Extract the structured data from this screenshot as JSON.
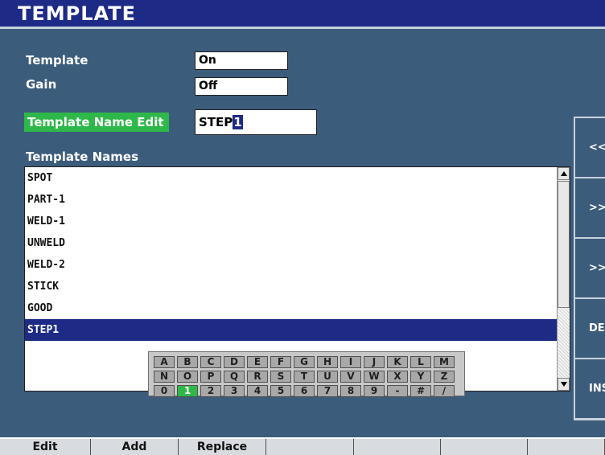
{
  "title": "TEMPLATE",
  "settings": {
    "template_label": "Template",
    "template_value": "On",
    "gain_label": "Gain",
    "gain_value": "Off",
    "name_edit_label": "Template Name Edit",
    "name_edit_value": "STEP",
    "name_edit_cursor": "1"
  },
  "list": {
    "header": "Template Names",
    "items": [
      "SPOT",
      "PART-1",
      "WELD-1",
      "UNWELD",
      "WELD-2",
      "STICK",
      "GOOD",
      "STEP1"
    ],
    "selected_index": 7
  },
  "keyboard": {
    "rows": [
      [
        "A",
        "B",
        "C",
        "D",
        "E",
        "F",
        "G",
        "H",
        "I",
        "J",
        "K",
        "L",
        "M"
      ],
      [
        "N",
        "O",
        "P",
        "Q",
        "R",
        "S",
        "T",
        "U",
        "V",
        "W",
        "X",
        "Y",
        "Z"
      ],
      [
        "0",
        "1",
        "2",
        "3",
        "4",
        "5",
        "6",
        "7",
        "8",
        "9",
        "-",
        "#",
        "/"
      ]
    ],
    "active_key": "1"
  },
  "sidebar": {
    "buttons": [
      "<<",
      ">>",
      ">>|",
      "DEL",
      "INS"
    ]
  },
  "bottom": {
    "buttons": [
      "Edit",
      "Add",
      "Replace",
      "",
      "",
      "",
      ""
    ]
  },
  "colors": {
    "background": "#3c5c7c",
    "titlebar": "#1d2a86",
    "highlight": "#2fb84a",
    "selection": "#1d2a86"
  }
}
